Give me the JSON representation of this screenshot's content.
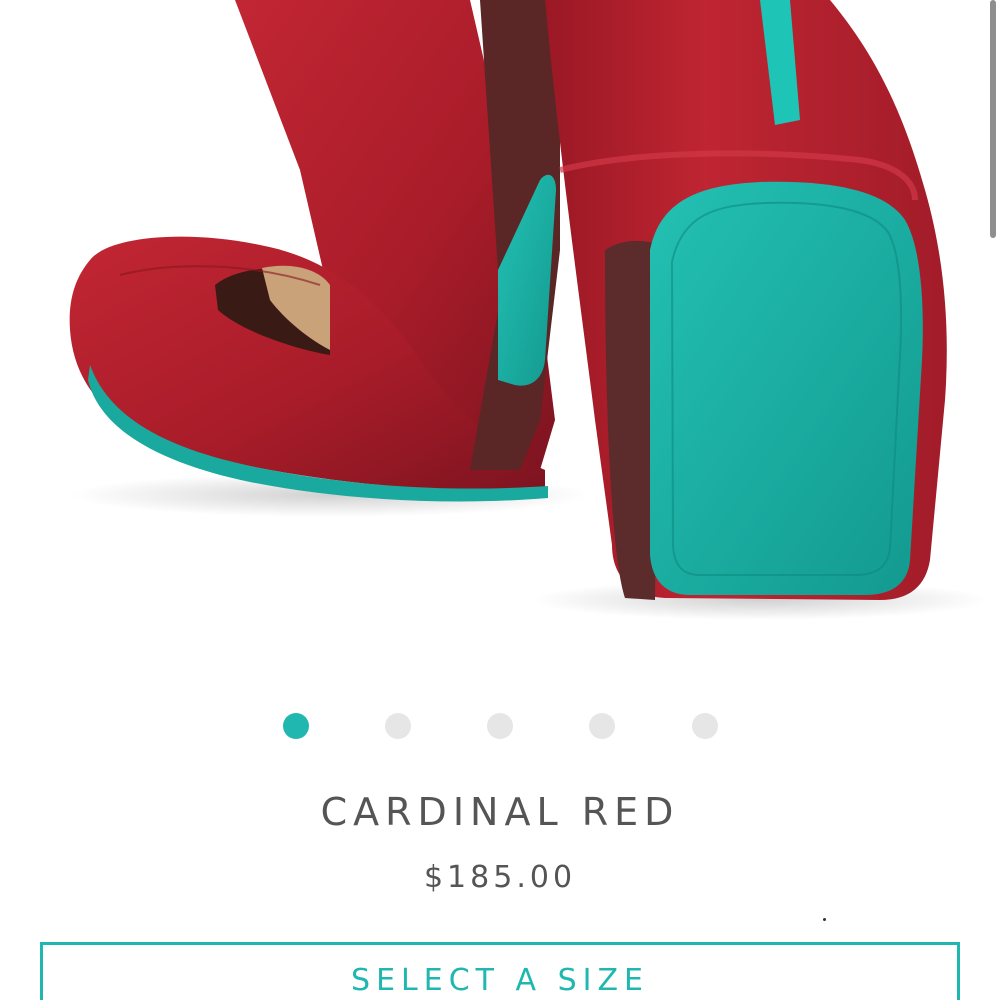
{
  "product": {
    "image_alt": "cardinal-red-ballet-flats",
    "title": "CARDINAL RED",
    "price": "$185.00"
  },
  "carousel": {
    "dot_count": 5,
    "active_index": 0
  },
  "actions": {
    "select_size_label": "SELECT A SIZE"
  },
  "colors": {
    "accent": "#1fb7b0",
    "shoe_red": "#b21f2c",
    "sole_teal": "#1aa99e",
    "text": "#555555"
  }
}
